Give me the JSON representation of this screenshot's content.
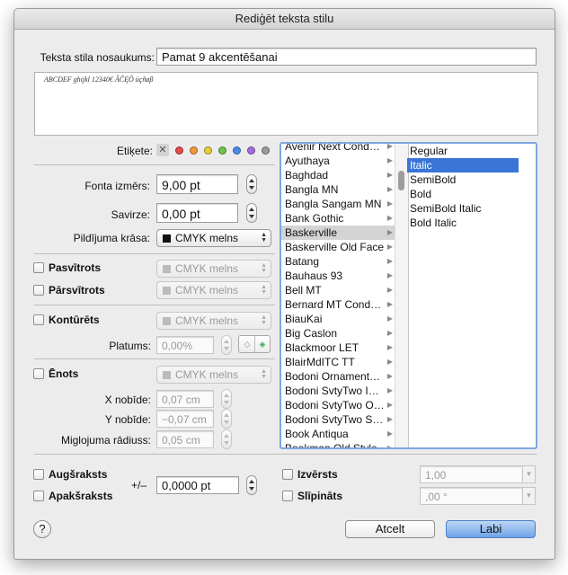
{
  "window_title": "Rediģēt teksta stilu",
  "style_name": {
    "label": "Teksta stila nosaukums:",
    "value": "Pamat 9 akcentēšanai"
  },
  "preview_text": "ABCDEF ghijkl 12340€ ÃĈĘÕ ùçñøβ",
  "tags": {
    "label": "Etiķete:",
    "colors": [
      "#e64b4b",
      "#f0963a",
      "#e8cf3a",
      "#6cc44a",
      "#4a8de8",
      "#a46be0",
      "#9a9a9a"
    ]
  },
  "font_size": {
    "label": "Fonta izmērs:",
    "value": "9,00 pt"
  },
  "kerning": {
    "label": "Savirze:",
    "value": "0,00 pt"
  },
  "fill_color": {
    "label": "Pildījuma krāsa:",
    "value": "CMYK melns"
  },
  "underline": {
    "label": "Pasvītrots",
    "value": "CMYK melns"
  },
  "strikethrough": {
    "label": "Pārsvītrots",
    "value": "CMYK melns"
  },
  "outline": {
    "label": "Kontūrēts",
    "value": "CMYK melns",
    "width_label": "Platums:",
    "width_value": "0,00%"
  },
  "shadow": {
    "label": "Ēnots",
    "value": "CMYK melns",
    "x_label": "X nobīde:",
    "x_value": "0,07 cm",
    "y_label": "Y nobīde:",
    "y_value": "−0,07 cm",
    "blur_label": "Miglojuma rādiuss:",
    "blur_value": "0,05 cm"
  },
  "font_families": [
    "Avenir Next Cond…",
    "Ayuthaya",
    "Baghdad",
    "Bangla MN",
    "Bangla Sangam MN",
    "Bank Gothic",
    "Baskerville",
    "Baskerville Old Face",
    "Batang",
    "Bauhaus 93",
    "Bell MT",
    "Bernard MT Cond…",
    "BiauKai",
    "Big Caslon",
    "Blackmoor LET",
    "BlairMdITC TT",
    "Bodoni Ornament…",
    "Bodoni SvtyTwo I…",
    "Bodoni SvtyTwo O…",
    "Bodoni SvtyTwo S…",
    "Book Antiqua",
    "Bookman Old Style"
  ],
  "selected_family": "Baskerville",
  "font_styles": [
    "Regular",
    "Italic",
    "SemiBold",
    "Bold",
    "SemiBold Italic",
    "Bold Italic"
  ],
  "selected_style": "Italic",
  "superscript": {
    "label": "Augšraksts"
  },
  "subscript": {
    "label": "Apakšraksts"
  },
  "baseline": {
    "label": "+/–",
    "value": "0,0000 pt"
  },
  "expanded": {
    "label": "Izvērsts",
    "value": "1,00"
  },
  "italicized": {
    "label": "Slīpināts",
    "value": ",00 °"
  },
  "buttons": {
    "help": "?",
    "cancel": "Atcelt",
    "ok": "Labi"
  }
}
